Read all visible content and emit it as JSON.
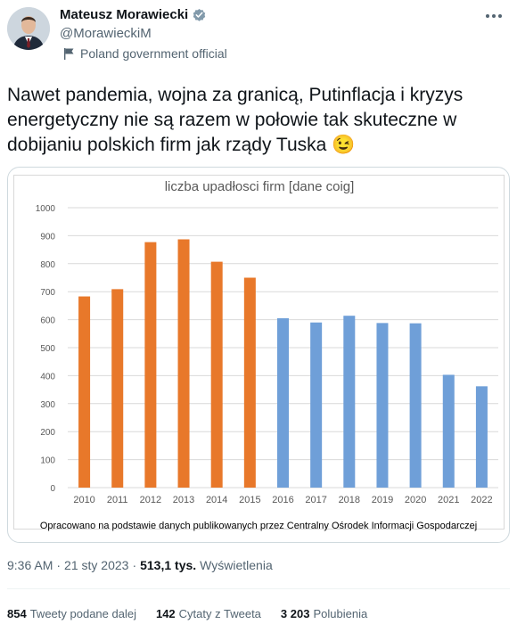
{
  "author": {
    "name": "Mateusz Morawiecki",
    "handle": "@MorawieckiM",
    "label": "Poland government official"
  },
  "tweet": {
    "text": "Nawet pandemia, wojna za granicą, Putinflacja i kryzys energetyczny nie są razem w połowie tak skuteczne w dobijaniu polskich firm jak rządy Tuska 😉"
  },
  "chart_data": {
    "type": "bar",
    "title": "liczba upadłosci firm [dane coig]",
    "categories": [
      "2010",
      "2011",
      "2012",
      "2013",
      "2014",
      "2015",
      "2016",
      "2017",
      "2018",
      "2019",
      "2020",
      "2021",
      "2022"
    ],
    "values": [
      683,
      709,
      877,
      887,
      807,
      750,
      605,
      590,
      614,
      588,
      587,
      403,
      362
    ],
    "bar_colors": [
      "#e8782a",
      "#e8782a",
      "#e8782a",
      "#e8782a",
      "#e8782a",
      "#e8782a",
      "#6f9fd8",
      "#6f9fd8",
      "#6f9fd8",
      "#6f9fd8",
      "#6f9fd8",
      "#6f9fd8",
      "#6f9fd8"
    ],
    "ylim": [
      0,
      1000
    ],
    "yticks": [
      "0",
      "100",
      "200",
      "300",
      "400",
      "500",
      "600",
      "700",
      "800",
      "900",
      "1000"
    ],
    "grid": true,
    "legend": "none"
  },
  "chart_source": "Opracowano na podstawie danych publikowanych przez Centralny Ośrodek Informacji Gospodarczej",
  "meta": {
    "time": "9:36 AM",
    "sep": "·",
    "date": "21 sty 2023",
    "views_count": "513,1 tys.",
    "views_label": "Wyświetlenia"
  },
  "stats": {
    "retweets_count": "854",
    "retweets_label": "Tweety podane dalej",
    "quotes_count": "142",
    "quotes_label": "Cytaty z Tweeta",
    "likes_count": "3 203",
    "likes_label": "Polubienia"
  },
  "colors": {
    "verified": "#829aab",
    "orange": "#e8782a",
    "blue": "#6f9fd8"
  }
}
